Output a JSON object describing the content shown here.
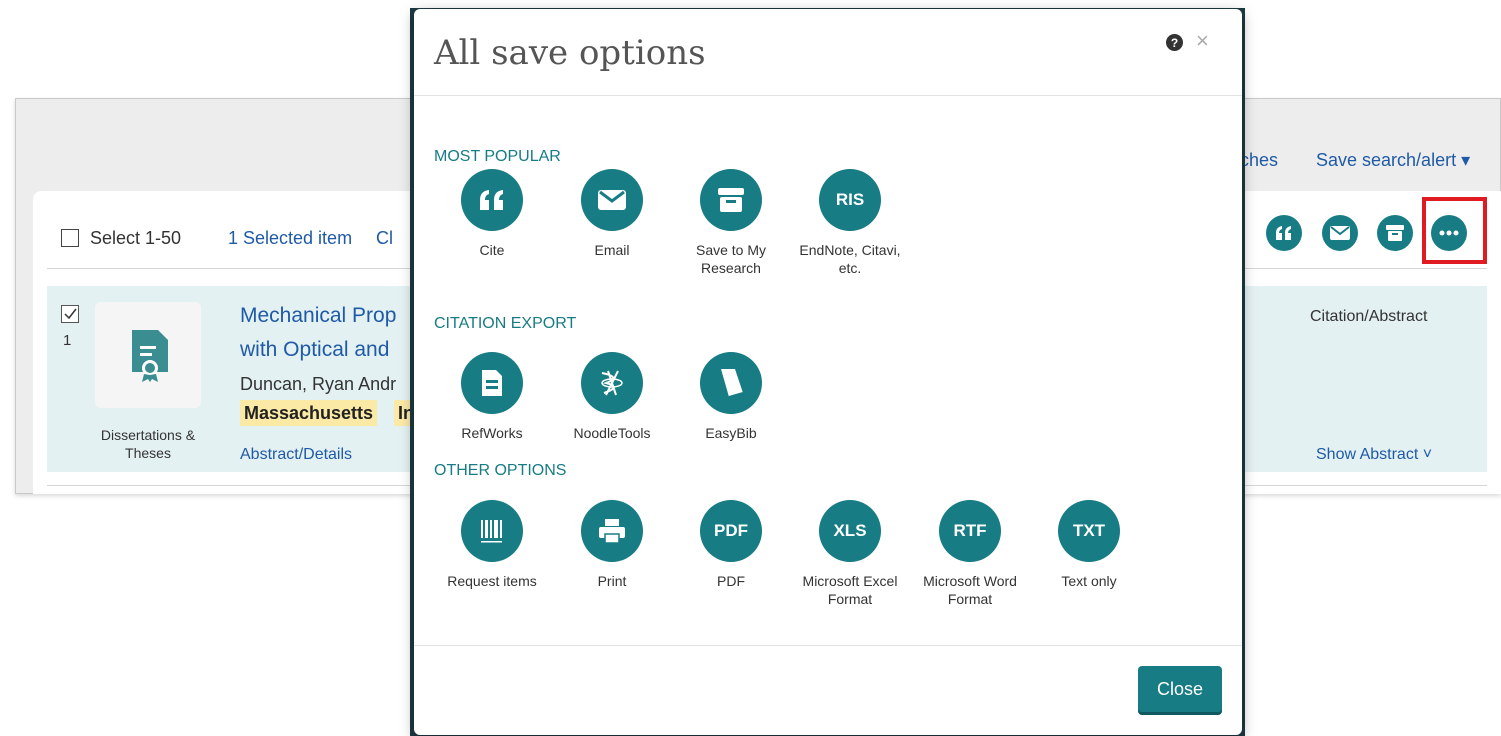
{
  "background": {
    "header_links": {
      "saved_searches_partial": "ches",
      "save_search": "Save search/alert ▾"
    },
    "toolbar": {
      "select_label": "Select 1-50",
      "selected_count": "1 Selected item",
      "clear_partial": "Cl"
    },
    "result": {
      "index": "1",
      "title_line1": "Mechanical Prop",
      "title_line2": "with Optical and",
      "author": "Duncan, Ryan Andr",
      "highlight1": "Massachusetts",
      "highlight2": "In",
      "type": "Dissertations & Theses",
      "abstract_link": "Abstract/Details",
      "citation_abstract": "Citation/Abstract",
      "show_abstract": "Show Abstract ˅"
    }
  },
  "modal": {
    "title": "All save options",
    "sections": [
      {
        "heading": "MOST POPULAR",
        "options": [
          {
            "icon": "quote-icon",
            "label": "Cite"
          },
          {
            "icon": "envelope-icon",
            "label": "Email"
          },
          {
            "icon": "archive-box-icon",
            "label": "Save to My Research"
          },
          {
            "icon": "RIS",
            "label": "EndNote, Citavi, etc."
          }
        ]
      },
      {
        "heading": "CITATION EXPORT",
        "options": [
          {
            "icon": "document-icon",
            "label": "RefWorks"
          },
          {
            "icon": "noodletools-icon",
            "label": "NoodleTools"
          },
          {
            "icon": "easybib-icon",
            "label": "EasyBib"
          }
        ]
      },
      {
        "heading": "OTHER OPTIONS",
        "options": [
          {
            "icon": "barcode-icon",
            "label": "Request items"
          },
          {
            "icon": "printer-icon",
            "label": "Print"
          },
          {
            "icon": "PDF",
            "label": "PDF"
          },
          {
            "icon": "XLS",
            "label": "Microsoft Excel Format"
          },
          {
            "icon": "RTF",
            "label": "Microsoft Word Format"
          },
          {
            "icon": "TXT",
            "label": "Text only"
          }
        ]
      }
    ],
    "close_label": "Close",
    "help_glyph": "?",
    "close_glyph": "×"
  },
  "colors": {
    "accent": "#177c84",
    "highlight": "#fbe9a6",
    "link": "#1f5aa6",
    "annotation": "#e01b22"
  }
}
